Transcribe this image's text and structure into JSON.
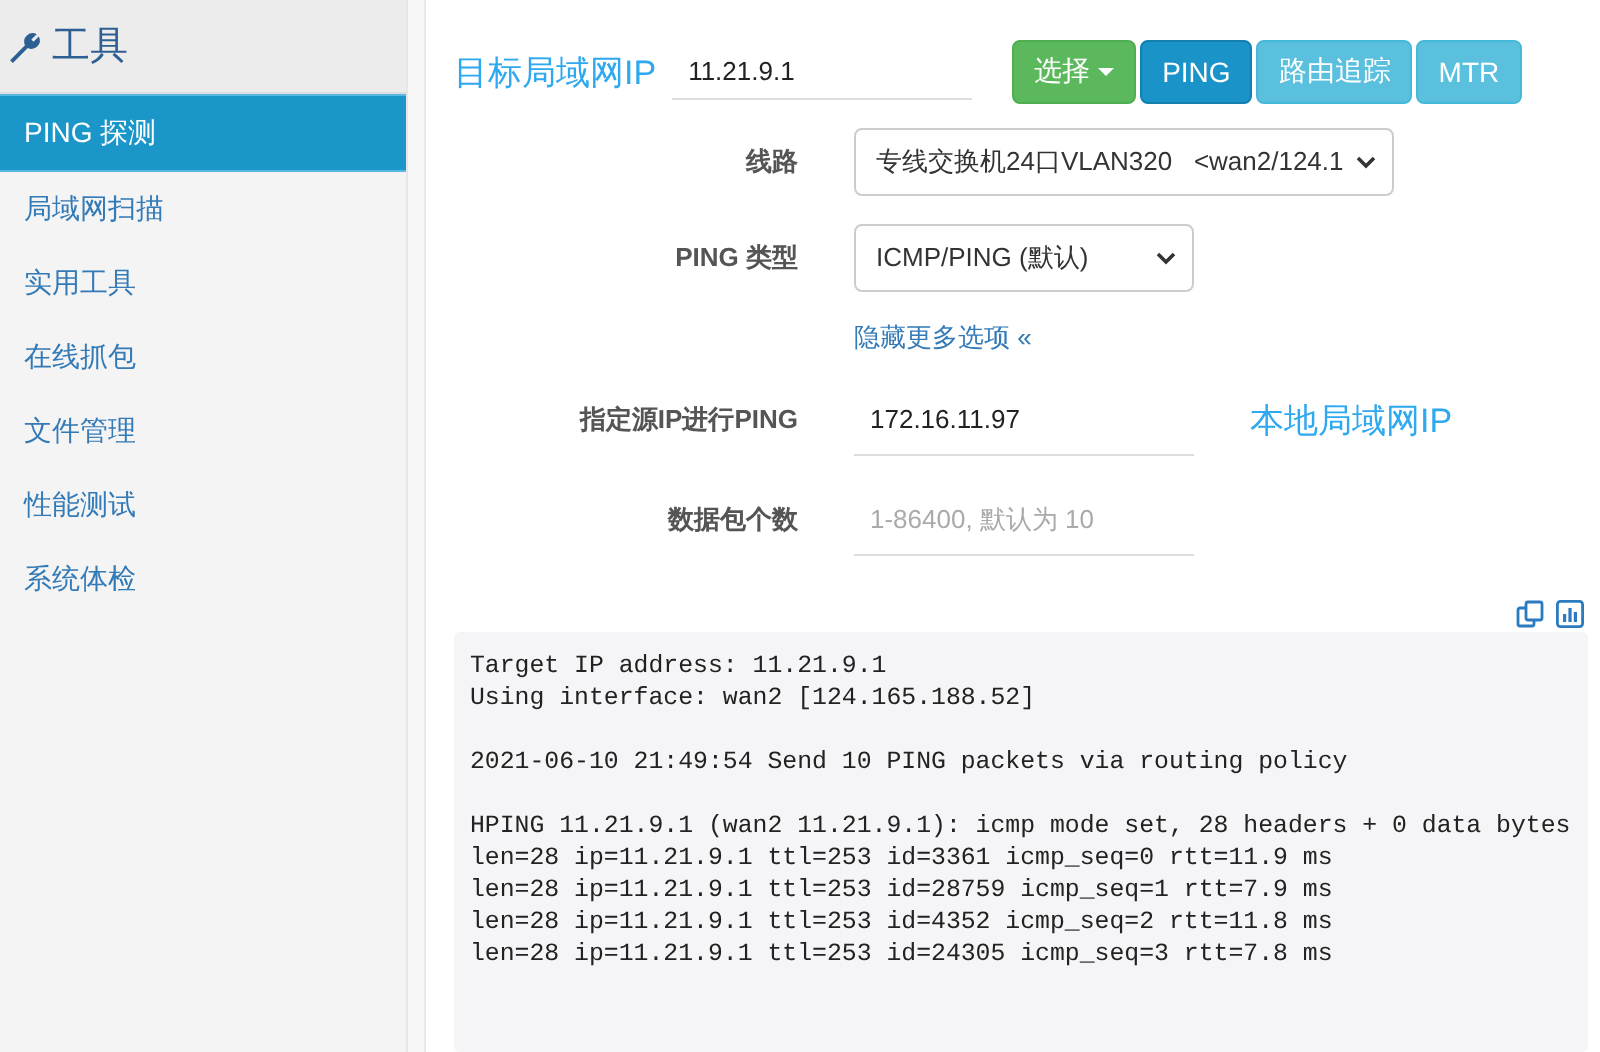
{
  "sidebar": {
    "title": "工具",
    "items": [
      {
        "label": "PING 探测",
        "selected": true
      },
      {
        "label": "局域网扫描",
        "selected": false
      },
      {
        "label": "实用工具",
        "selected": false
      },
      {
        "label": "在线抓包",
        "selected": false
      },
      {
        "label": "文件管理",
        "selected": false
      },
      {
        "label": "性能测试",
        "selected": false
      },
      {
        "label": "系统体检",
        "selected": false
      }
    ]
  },
  "target": {
    "annotation": "目标局域网IP",
    "value": "11.21.9.1"
  },
  "buttons": [
    {
      "label": "选择",
      "kind": "success",
      "caret": true
    },
    {
      "label": "PING",
      "kind": "primary",
      "caret": false
    },
    {
      "label": "路由追踪",
      "kind": "info",
      "caret": false
    },
    {
      "label": "MTR",
      "kind": "info",
      "caret": false
    }
  ],
  "form": [
    {
      "kind": "select",
      "label": "线路",
      "value": "专线交换机24口VLAN320   <wan2/124.1",
      "wide": true
    },
    {
      "kind": "select",
      "label": "PING 类型",
      "value": "ICMP/PING (默认)",
      "wide": false
    },
    {
      "kind": "link",
      "label": "隐藏更多选项 «"
    },
    {
      "kind": "input",
      "label": "指定源IP进行PING",
      "value": "172.16.11.97",
      "annotation": "本地局域网IP"
    },
    {
      "kind": "input",
      "label": "数据包个数",
      "placeholder": "1-86400, 默认为 10"
    }
  ],
  "output": [
    [
      "Target IP address: 11.21.9.1",
      "Using interface: wan2 [124.165.188.52]"
    ],
    [
      "2021-06-10 21:49:54 Send 10 PING packets via routing policy"
    ],
    [
      "HPING 11.21.9.1 (wan2 11.21.9.1): icmp mode set, 28 headers + 0 data bytes",
      "len=28 ip=11.21.9.1 ttl=253 id=3361 icmp_seq=0 rtt=11.9 ms",
      "len=28 ip=11.21.9.1 ttl=253 id=28759 icmp_seq=1 rtt=7.9 ms",
      "len=28 ip=11.21.9.1 ttl=253 id=4352 icmp_seq=2 rtt=11.8 ms",
      "len=28 ip=11.21.9.1 ttl=253 id=24305 icmp_seq=3 rtt=7.8 ms"
    ]
  ]
}
